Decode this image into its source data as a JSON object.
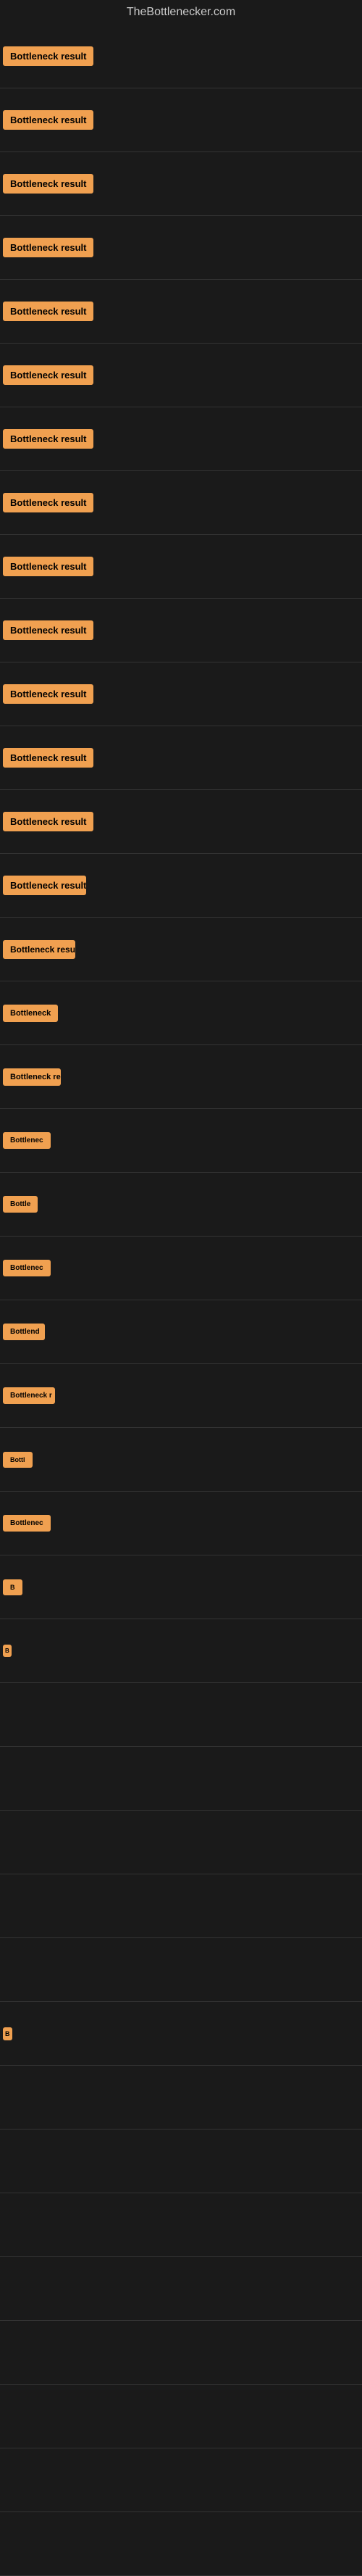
{
  "site": {
    "title": "TheBottlenecker.com"
  },
  "badge_label": "Bottleneck result",
  "items": [
    {
      "id": 1,
      "label": "Bottleneck result",
      "visible_text": "Bottleneck result"
    },
    {
      "id": 2,
      "label": "Bottleneck result",
      "visible_text": "Bottleneck result"
    },
    {
      "id": 3,
      "label": "Bottleneck result",
      "visible_text": "Bottleneck result"
    },
    {
      "id": 4,
      "label": "Bottleneck result",
      "visible_text": "Bottleneck result"
    },
    {
      "id": 5,
      "label": "Bottleneck result",
      "visible_text": "Bottleneck result"
    },
    {
      "id": 6,
      "label": "Bottleneck result",
      "visible_text": "Bottleneck result"
    },
    {
      "id": 7,
      "label": "Bottleneck result",
      "visible_text": "Bottleneck result"
    },
    {
      "id": 8,
      "label": "Bottleneck result",
      "visible_text": "Bottleneck result"
    },
    {
      "id": 9,
      "label": "Bottleneck result",
      "visible_text": "Bottleneck result"
    },
    {
      "id": 10,
      "label": "Bottleneck result",
      "visible_text": "Bottleneck result"
    },
    {
      "id": 11,
      "label": "Bottleneck result",
      "visible_text": "Bottleneck result"
    },
    {
      "id": 12,
      "label": "Bottleneck result",
      "visible_text": "Bottleneck result"
    },
    {
      "id": 13,
      "label": "Bottleneck result",
      "visible_text": "Bottleneck result"
    },
    {
      "id": 14,
      "label": "Bottleneck result",
      "visible_text": "Bottleneck result"
    },
    {
      "id": 15,
      "label": "Bottleneck resu",
      "visible_text": "Bottleneck resu"
    },
    {
      "id": 16,
      "label": "Bottleneck",
      "visible_text": "Bottleneck"
    },
    {
      "id": 17,
      "label": "Bottleneck re",
      "visible_text": "Bottleneck re"
    },
    {
      "id": 18,
      "label": "Bottlenec",
      "visible_text": "Bottlenec"
    },
    {
      "id": 19,
      "label": "Bottle",
      "visible_text": "Bottle"
    },
    {
      "id": 20,
      "label": "Bottlenec",
      "visible_text": "Bottlenec"
    },
    {
      "id": 21,
      "label": "Bottlend",
      "visible_text": "Bottlend"
    },
    {
      "id": 22,
      "label": "Bottleneck r",
      "visible_text": "Bottleneck r"
    },
    {
      "id": 23,
      "label": "Bottl",
      "visible_text": "Bottl"
    },
    {
      "id": 24,
      "label": "Bottlenec",
      "visible_text": "Bottlenec"
    },
    {
      "id": 25,
      "label": "B",
      "visible_text": "B"
    },
    {
      "id": 26,
      "label": "B",
      "visible_text": "B"
    }
  ],
  "colors": {
    "badge_bg": "#f0a050",
    "badge_text": "#000000",
    "page_bg": "#1a1a1a",
    "title_text": "#cccccc"
  }
}
